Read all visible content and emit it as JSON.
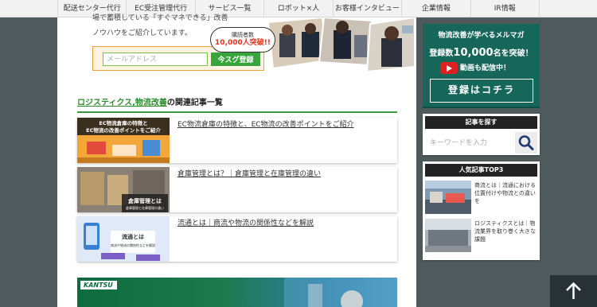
{
  "nav": {
    "items": [
      {
        "label": "配送センター代行"
      },
      {
        "label": "EC受注管理代行"
      },
      {
        "label": "サービス一覧"
      },
      {
        "label": "ロボット×人"
      },
      {
        "label": "お客様インタビュー"
      },
      {
        "label": "企業情報"
      },
      {
        "label": "IR情報"
      }
    ]
  },
  "intro": {
    "line1": "場で蓄積している「すぐマネできる」改善",
    "line2": "ノウハウをご紹介しています。"
  },
  "signup": {
    "email_placeholder": "メールアドレス",
    "button_label": "今スグ登録",
    "bubble_small": "購読者数",
    "bubble_big": "10,000人突破!!"
  },
  "section": {
    "title_highlight": "ロジスティクス,物流改善",
    "title_rest": "の関連記事一覧"
  },
  "articles": [
    {
      "title": "EC物流倉庫の特徴と、EC物流の改善ポイントをご紹介",
      "thumb_text1": "EC物流倉庫の特徴と",
      "thumb_text2": "EC物流の改善ポイントをご紹介"
    },
    {
      "title": "倉庫管理とは？｜倉庫管理と在庫管理の違い",
      "thumb_text1": "倉庫管理とは",
      "thumb_text2": "倉庫管理と在庫管理の違い"
    },
    {
      "title": "流通とは｜商流や物流の関係性などを解説",
      "thumb_text1": "流通とは",
      "thumb_text2": "商流や物流の関係性などを解説"
    }
  ],
  "banner_bottom": {
    "logo_text": "KANTSU"
  },
  "sidebar": {
    "magazine": {
      "title": "物流改善が学べるメルマガ",
      "count_prefix": "登録数",
      "count_number": "10,000",
      "count_suffix": "名を突破！",
      "video_text": "動画も配信中！",
      "button_label": "登録はコチラ"
    },
    "search": {
      "heading": "記事を探す",
      "placeholder": "キーワードを入力"
    },
    "popular": {
      "heading": "人気記事TOP3",
      "items": [
        {
          "title": "商流とは｜流通における位置付けや物流との違いを"
        },
        {
          "title": "ロジスティクスとは｜物流業界を取り巻く大きな課題"
        }
      ]
    }
  },
  "colors": {
    "accent_green": "#37a53b",
    "sidebar_teal": "#16665a",
    "page_bg": "#4f5a5c"
  },
  "icons": [
    "search-icon",
    "youtube-play-icon",
    "arrow-up-icon"
  ]
}
